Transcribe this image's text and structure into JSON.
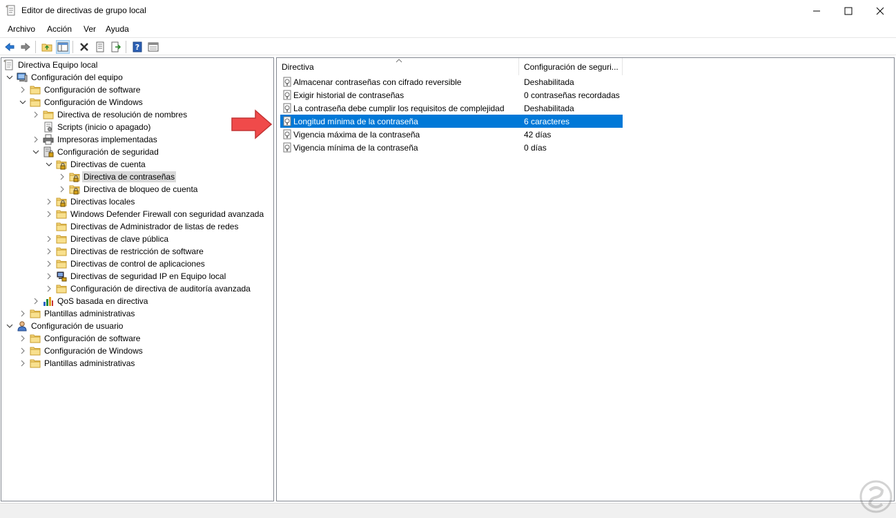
{
  "window": {
    "title": "Editor de directivas de grupo local",
    "icon": "gpedit-scroll-icon",
    "controls": [
      "minimize-icon",
      "maximize-icon",
      "close-icon"
    ]
  },
  "menu": [
    "Archivo",
    "Acción",
    "Ver",
    "Ayuda"
  ],
  "toolbar": {
    "buttons": [
      "back-arrow-icon",
      "forward-arrow-icon",
      "up-folder-icon",
      "show-hide-tree-icon",
      "delete-icon",
      "properties-icon",
      "export-list-icon",
      "help-icon",
      "view-icon"
    ]
  },
  "tree": [
    {
      "label": "Directiva Equipo local",
      "icon": "policy-scroll-icon",
      "expand": "none"
    },
    {
      "label": "Configuración del equipo",
      "icon": "computer-icon",
      "expand": "open"
    },
    {
      "label": "Configuración de software",
      "icon": "folder-icon",
      "expand": "closed"
    },
    {
      "label": "Configuración de Windows",
      "icon": "folder-icon",
      "expand": "open"
    },
    {
      "label": "Directiva de resolución de nombres",
      "icon": "folder-icon",
      "expand": "closed"
    },
    {
      "label": "Scripts (inicio o apagado)",
      "icon": "script-icon",
      "expand": "none"
    },
    {
      "label": "Impresoras implementadas",
      "icon": "printer-icon",
      "expand": "closed"
    },
    {
      "label": "Configuración de seguridad",
      "icon": "security-icon",
      "expand": "open"
    },
    {
      "label": "Directivas de cuenta",
      "icon": "lock-folder-icon",
      "expand": "open"
    },
    {
      "label": "Directiva de contraseñas",
      "icon": "lock-folder-icon",
      "expand": "closed",
      "selected": true
    },
    {
      "label": "Directiva de bloqueo de cuenta",
      "icon": "lock-folder-icon",
      "expand": "closed"
    },
    {
      "label": "Directivas locales",
      "icon": "lock-folder-icon",
      "expand": "closed"
    },
    {
      "label": "Windows Defender Firewall con seguridad avanzada",
      "icon": "folder-icon",
      "expand": "closed"
    },
    {
      "label": "Directivas de Administrador de listas de redes",
      "icon": "folder-icon",
      "expand": "none"
    },
    {
      "label": "Directivas de clave pública",
      "icon": "folder-icon",
      "expand": "closed"
    },
    {
      "label": "Directivas de restricción de software",
      "icon": "folder-icon",
      "expand": "closed"
    },
    {
      "label": "Directivas de control de aplicaciones",
      "icon": "folder-icon",
      "expand": "closed"
    },
    {
      "label": "Directivas de seguridad IP en Equipo local",
      "icon": "ip-security-icon",
      "expand": "closed"
    },
    {
      "label": "Configuración de directiva de auditoría avanzada",
      "icon": "folder-icon",
      "expand": "closed"
    },
    {
      "label": "QoS basada en directiva",
      "icon": "qos-chart-icon",
      "expand": "closed"
    },
    {
      "label": "Plantillas administrativas",
      "icon": "folder-icon",
      "expand": "closed"
    },
    {
      "label": "Configuración de usuario",
      "icon": "user-icon",
      "expand": "open"
    },
    {
      "label": "Configuración de software",
      "icon": "folder-icon",
      "expand": "closed"
    },
    {
      "label": "Configuración de Windows",
      "icon": "folder-icon",
      "expand": "closed"
    },
    {
      "label": "Plantillas administrativas",
      "icon": "folder-icon",
      "expand": "closed"
    }
  ],
  "list": {
    "columns": [
      "Directiva",
      "Configuración de seguri..."
    ],
    "rows": [
      {
        "name": "Almacenar contraseñas con cifrado reversible",
        "value": "Deshabilitada"
      },
      {
        "name": "Exigir historial de contraseñas",
        "value": "0 contraseñas recordadas"
      },
      {
        "name": "La contraseña debe cumplir los requisitos de complejidad",
        "value": "Deshabilitada"
      },
      {
        "name": "Longitud mínima de la contraseña",
        "value": "6 caracteres",
        "selected": true
      },
      {
        "name": "Vigencia máxima de la contraseña",
        "value": "42 días"
      },
      {
        "name": "Vigencia mínima de la contraseña",
        "value": "0 días"
      }
    ]
  },
  "colors": {
    "selection": "#0078d7",
    "arrow": "#f04a4a",
    "folder": "#f5d67b"
  }
}
